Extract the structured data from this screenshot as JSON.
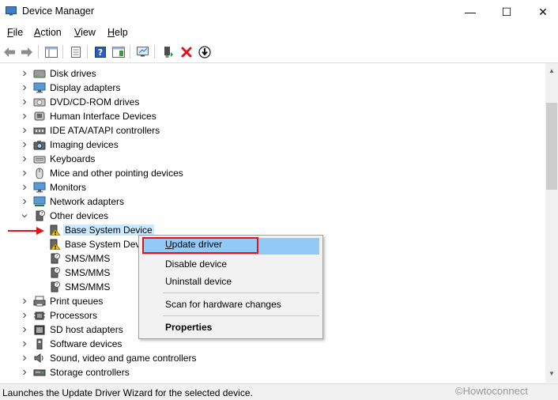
{
  "window": {
    "title": "Device Manager",
    "minimize": "—",
    "maximize": "☐",
    "close": "✕"
  },
  "menu": {
    "file": "F",
    "file_rest": "ile",
    "action": "A",
    "action_rest": "ction",
    "view": "V",
    "view_rest": "iew",
    "help": "H",
    "help_rest": "elp"
  },
  "tree": [
    {
      "label": "Disk drives",
      "state": "collapsed",
      "level": 1,
      "icon": "disk-icon"
    },
    {
      "label": "Display adapters",
      "state": "collapsed",
      "level": 1,
      "icon": "monitor-icon"
    },
    {
      "label": "DVD/CD-ROM drives",
      "state": "collapsed",
      "level": 1,
      "icon": "dvd-icon"
    },
    {
      "label": "Human Interface Devices",
      "state": "collapsed",
      "level": 1,
      "icon": "hid-icon"
    },
    {
      "label": "IDE ATA/ATAPI controllers",
      "state": "collapsed",
      "level": 1,
      "icon": "ide-icon"
    },
    {
      "label": "Imaging devices",
      "state": "collapsed",
      "level": 1,
      "icon": "camera-icon"
    },
    {
      "label": "Keyboards",
      "state": "collapsed",
      "level": 1,
      "icon": "keyboard-icon"
    },
    {
      "label": "Mice and other pointing devices",
      "state": "collapsed",
      "level": 1,
      "icon": "mouse-icon"
    },
    {
      "label": "Monitors",
      "state": "collapsed",
      "level": 1,
      "icon": "monitor-icon"
    },
    {
      "label": "Network adapters",
      "state": "collapsed",
      "level": 1,
      "icon": "network-icon"
    },
    {
      "label": "Other devices",
      "state": "expanded",
      "level": 1,
      "icon": "unknown-device-icon"
    },
    {
      "label": "Base System Device",
      "state": "leaf",
      "level": 2,
      "icon": "warning-device-icon",
      "selected": true
    },
    {
      "label": "Base System Devi",
      "state": "leaf",
      "level": 2,
      "icon": "warning-device-icon"
    },
    {
      "label": "SMS/MMS",
      "state": "leaf",
      "level": 2,
      "icon": "unknown-device-icon"
    },
    {
      "label": "SMS/MMS",
      "state": "leaf",
      "level": 2,
      "icon": "unknown-device-icon"
    },
    {
      "label": "SMS/MMS",
      "state": "leaf",
      "level": 2,
      "icon": "unknown-device-icon"
    },
    {
      "label": "Print queues",
      "state": "collapsed",
      "level": 1,
      "icon": "printer-icon"
    },
    {
      "label": "Processors",
      "state": "collapsed",
      "level": 1,
      "icon": "cpu-icon"
    },
    {
      "label": "SD host adapters",
      "state": "collapsed",
      "level": 1,
      "icon": "sd-icon"
    },
    {
      "label": "Software devices",
      "state": "collapsed",
      "level": 1,
      "icon": "software-icon"
    },
    {
      "label": "Sound, video and game controllers",
      "state": "collapsed",
      "level": 1,
      "icon": "speaker-icon"
    },
    {
      "label": "Storage controllers",
      "state": "collapsed",
      "level": 1,
      "icon": "storage-icon"
    }
  ],
  "context_menu": {
    "update_driver": "Update driver",
    "disable_device": "Disable device",
    "uninstall_device": "Uninstall device",
    "scan": "Scan for hardware changes",
    "properties": "Properties"
  },
  "status": {
    "text": "Launches the Update Driver Wizard for the selected device."
  },
  "watermark": "©Howtoconnect",
  "colors": {
    "selection": "#cce8ff",
    "menu_hover": "#91c9f7",
    "highlight_box": "#e0151b",
    "arrow": "#e0151b"
  }
}
